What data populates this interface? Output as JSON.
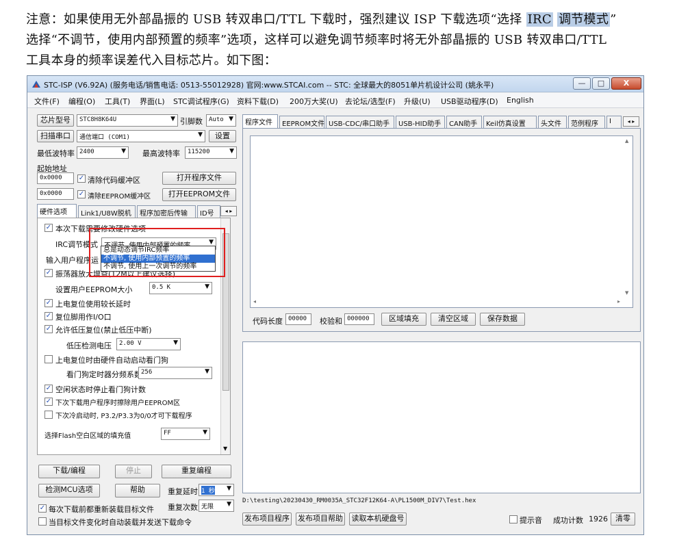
{
  "doc": {
    "line1_pre": "注意：如果使用无外部晶振的 USB 转双串口/TTL 下载时，强烈建议 ISP 下载选项“选择 ",
    "line1_hl1": "IRC",
    "line1_mid": " ",
    "line1_hl2": "调节模式",
    "line1_post": "”",
    "line2": "选择“不调节，使用内部预置的频率”选项，这样可以避免调节频率时将无外部晶振的 USB 转双串口/TTL",
    "line3": "工具本身的频率误差代入目标芯片。如下图："
  },
  "window": {
    "title": "STC-ISP (V6.92A) (服务电话/销售电话: 0513-55012928) 官网:www.STCAI.com  -- STC: 全球最大的8051单片机设计公司 (姚永平)",
    "min": "—",
    "max": "□",
    "close": "X"
  },
  "menu": [
    "文件(F)",
    "编程(O)",
    "工具(T)",
    "界面(L)",
    "STC调试程序(G)",
    "资料下载(D)",
    "200万大奖(U)",
    "去论坛/选型(F)",
    "升级(U)",
    "USB驱动程序(D)",
    "English"
  ],
  "left": {
    "chip_btn": "芯片型号",
    "chip_value": "STC8H8K64U",
    "pins_label": "引脚数",
    "pins_value": "Auto",
    "scan_btn": "扫描串口",
    "port_value": "通信端口 (COM1)",
    "settings_btn": "设置",
    "min_baud_label": "最低波特率",
    "min_baud_value": "2400",
    "max_baud_label": "最高波特率",
    "max_baud_value": "115200",
    "start_addr_label": "起始地址",
    "addr1": "0x0000",
    "clear_code": "清除代码缓冲区",
    "open_prog_btn": "打开程序文件",
    "addr2": "0x0000",
    "clear_eeprom": "清除EEPROM缓冲区",
    "open_eeprom_btn": "打开EEPROM文件"
  },
  "left_tabs": [
    "硬件选项",
    "Link1/U8W脱机",
    "程序加密后传输",
    "ID号"
  ],
  "hw": {
    "opt1": "本次下载需要修改硬件选项",
    "irc_label": "IRC调节模式",
    "irc_value": "不调节, 使用内部预置的频率",
    "input_label": "输入用户程序运",
    "osc_amp": "振荡器放大增益(12M以上建议选择)",
    "eeprom_label": "设置用户EEPROM大小",
    "eeprom_value": "0.5 K",
    "opt_delay": "上电复位使用较长延时",
    "opt_reset_io": "复位脚用作I/O口",
    "opt_lvr": "允许低压复位(禁止低压中断)",
    "lvd_label": "低压检测电压",
    "lvd_value": "2.00 V",
    "opt_wdt": "上电复位时由硬件自动启动看门狗",
    "wdt_label": "看门狗定时器分频系数",
    "wdt_value": "256",
    "opt_idle": "空闲状态时停止看门狗计数",
    "opt_erase": "下次下载用户程序时擦除用户EEPROM区",
    "opt_p32": "下次冷启动时, P3.2/P3.3为0/0才可下载程序",
    "flash_fill_label": "选择Flash空白区域的填充值",
    "flash_fill_value": "FF"
  },
  "dropdown": {
    "items": [
      "总是动态调节IRC频率",
      "不调节, 使用内部预置的频率",
      "不调节, 使用上一次调节的频率"
    ],
    "selected_index": 1
  },
  "bottom_left": {
    "download_btn": "下载/编程",
    "stop_btn": "停止",
    "reprogram_btn": "重复编程",
    "check_mcu_btn": "检测MCU选项",
    "help_btn": "帮助",
    "delay_label": "重复延时",
    "delay_value": "1 秒",
    "reload_label": "每次下载前都重新装载目标文件",
    "repeat_label": "重复次数",
    "repeat_value": "无限",
    "auto_label": "当目标文件变化时自动装载并发送下载命令"
  },
  "right_tabs": [
    "程序文件",
    "EEPROM文件",
    "USB-CDC/串口助手",
    "USB-HID助手",
    "CAN助手",
    "Keil仿真设置",
    "头文件",
    "范例程序",
    "I"
  ],
  "code": {
    "length_label": "代码长度",
    "length_value": "00000",
    "checksum_label": "校验和",
    "checksum_value": "000000",
    "fill_btn": "区域填充",
    "clear_btn": "清空区域",
    "save_btn": "保存数据"
  },
  "footer": {
    "path": "D:\\testing\\20230430_RM0035A_STC32F12K64-A\\PL1500M_DIV7\\Test.hex",
    "publish_prog_btn": "发布项目程序",
    "publish_help_btn": "发布项目帮助",
    "read_disk_btn": "读取本机硬盘号",
    "sound_label": "提示音",
    "success_label": "成功计数",
    "success_value": "1926",
    "reset_btn": "清零"
  },
  "colors": {
    "highlight": "#b9cde6",
    "redbox": "#e01e1e",
    "selection": "#3070d0"
  }
}
